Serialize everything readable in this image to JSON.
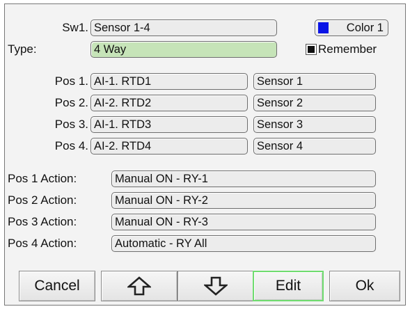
{
  "header": {
    "switch_label": "Sw1.",
    "switch_name": "Sensor 1-4",
    "color_label": "Color 1",
    "color_swatch": "#0a14e6",
    "type_label": "Type:",
    "type_value": "4 Way",
    "remember_label": "Remember",
    "remember_checked": true
  },
  "positions": [
    {
      "label": "Pos 1.",
      "source": "AI-1. RTD1",
      "name": "Sensor 1"
    },
    {
      "label": "Pos 2.",
      "source": "AI-2. RTD2",
      "name": "Sensor 2"
    },
    {
      "label": "Pos 3.",
      "source": "AI-1. RTD3",
      "name": "Sensor 3"
    },
    {
      "label": "Pos 4.",
      "source": "AI-2. RTD4",
      "name": "Sensor 4"
    }
  ],
  "actions": [
    {
      "label": "Pos 1 Action:",
      "value": "Manual ON - RY-1"
    },
    {
      "label": "Pos 2 Action:",
      "value": "Manual ON - RY-2"
    },
    {
      "label": "Pos 3 Action:",
      "value": "Manual ON - RY-3"
    },
    {
      "label": "Pos 4 Action:",
      "value": "Automatic - RY All"
    }
  ],
  "buttons": {
    "cancel": "Cancel",
    "up_icon": "arrow-up-icon",
    "down_icon": "arrow-down-icon",
    "edit": "Edit",
    "ok": "Ok",
    "edit_highlight_color": "#6fdc6f"
  }
}
